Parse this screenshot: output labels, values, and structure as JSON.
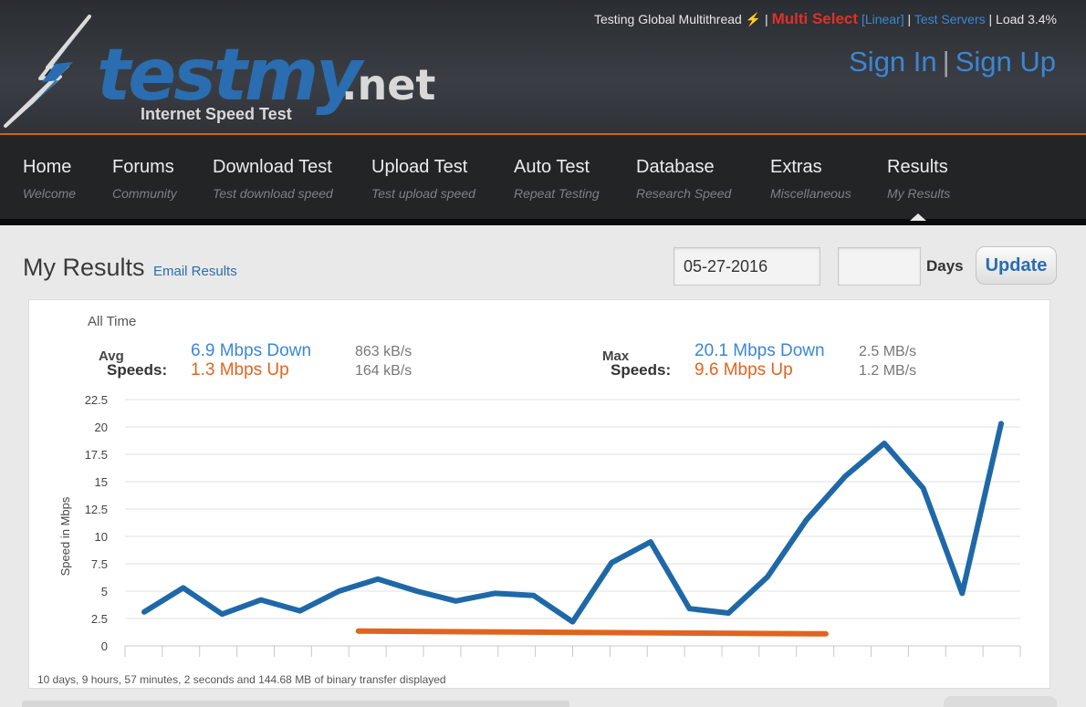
{
  "site": {
    "logo_word": "testmy",
    "logo_tld": ".net",
    "tagline": "Internet Speed Test"
  },
  "topbar": {
    "testing": "Testing Global Multithread",
    "multi_select": "Multi Select",
    "linear": "[Linear]",
    "test_servers": "Test Servers",
    "load": "Load 3.4%"
  },
  "auth": {
    "sign_in": "Sign In",
    "sign_up": "Sign Up"
  },
  "nav": [
    {
      "label": "Home",
      "sub": "Welcome"
    },
    {
      "label": "Forums",
      "sub": "Community"
    },
    {
      "label": "Download Test",
      "sub": "Test download speed"
    },
    {
      "label": "Upload Test",
      "sub": "Test upload speed"
    },
    {
      "label": "Auto Test",
      "sub": "Repeat Testing"
    },
    {
      "label": "Database",
      "sub": "Research Speed"
    },
    {
      "label": "Extras",
      "sub": "Miscellaneous"
    },
    {
      "label": "Results",
      "sub": "My Results"
    }
  ],
  "page": {
    "title": "My Results",
    "email_link": "Email Results",
    "date_value": "05-27-2016",
    "days_value": "",
    "days_label": "Days",
    "update_label": "Update"
  },
  "summary": {
    "period": "All Time",
    "avg_label_1": "Avg",
    "avg_label_2": "Speeds:",
    "avg_down": "6.9 Mbps Down",
    "avg_up": "1.3 Mbps Up",
    "avg_down_alt": "863 kB/s",
    "avg_up_alt": "164 kB/s",
    "max_label_1": "Max",
    "max_label_2": "Speeds:",
    "max_down": "20.1 Mbps Down",
    "max_up": "9.6 Mbps Up",
    "max_down_alt": "2.5 MB/s",
    "max_up_alt": "1.2 MB/s"
  },
  "footer_note": "10 days, 9 hours, 57 minutes, 2 seconds and 144.68 MB of binary transfer displayed",
  "colors": {
    "down": "#1f68a8",
    "up": "#e0641f",
    "accent": "#2a6db0"
  },
  "chart_data": {
    "type": "line",
    "ylabel": "Speed in Mbps",
    "ylim": [
      0,
      22.5
    ],
    "yticks": [
      0,
      2.5,
      5,
      7.5,
      10,
      12.5,
      15,
      17.5,
      20,
      22.5
    ],
    "ytick_labels": [
      "0",
      "2.5",
      "5",
      "7.5",
      "10",
      "12.5",
      "15",
      "17.5",
      "20",
      "22.5"
    ],
    "x_count": 23,
    "grid": true,
    "series": [
      {
        "key": "down",
        "x": [
          0,
          1,
          2,
          3,
          4,
          5,
          6,
          7,
          8,
          9,
          10,
          11,
          12,
          13,
          14,
          15,
          16,
          17,
          18,
          19,
          20,
          21,
          22
        ],
        "values": [
          3.1,
          5.3,
          2.9,
          4.2,
          3.2,
          5.0,
          6.1,
          5.0,
          4.1,
          4.8,
          4.6,
          2.2,
          7.6,
          9.5,
          3.4,
          3.0,
          6.3,
          11.5,
          15.5,
          18.5,
          14.4,
          4.8,
          20.3
        ]
      },
      {
        "key": "up",
        "x": [
          5.5,
          17.5
        ],
        "values": [
          1.35,
          1.1
        ]
      }
    ]
  }
}
